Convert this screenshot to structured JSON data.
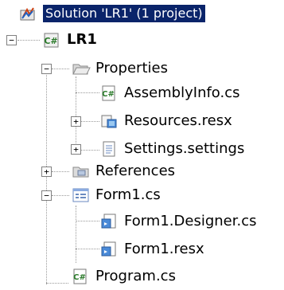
{
  "tree": {
    "solution": {
      "label": "Solution 'LR1' (1 project)",
      "icon": "solution-icon"
    },
    "project": {
      "label": "LR1",
      "icon": "csharp-project-icon",
      "expander": "−"
    },
    "properties": {
      "label": "Properties",
      "icon": "folder-open-icon",
      "expander": "−"
    },
    "assemblyinfo": {
      "label": "AssemblyInfo.cs",
      "icon": "csharp-file-icon"
    },
    "resources": {
      "label": "Resources.resx",
      "icon": "resx-icon",
      "expander": "+"
    },
    "settings": {
      "label": "Settings.settings",
      "icon": "settings-file-icon",
      "expander": "+"
    },
    "references": {
      "label": "References",
      "icon": "references-icon",
      "expander": "+"
    },
    "form1": {
      "label": "Form1.cs",
      "icon": "form-icon",
      "expander": "−"
    },
    "form1designer": {
      "label": "Form1.Designer.cs",
      "icon": "csharp-file-icon"
    },
    "form1resx": {
      "label": "Form1.resx",
      "icon": "resx-icon"
    },
    "program": {
      "label": "Program.cs",
      "icon": "csharp-file-icon"
    }
  },
  "colors": {
    "selection": "#0a246a",
    "tree_lines": "#9a9a9a"
  }
}
